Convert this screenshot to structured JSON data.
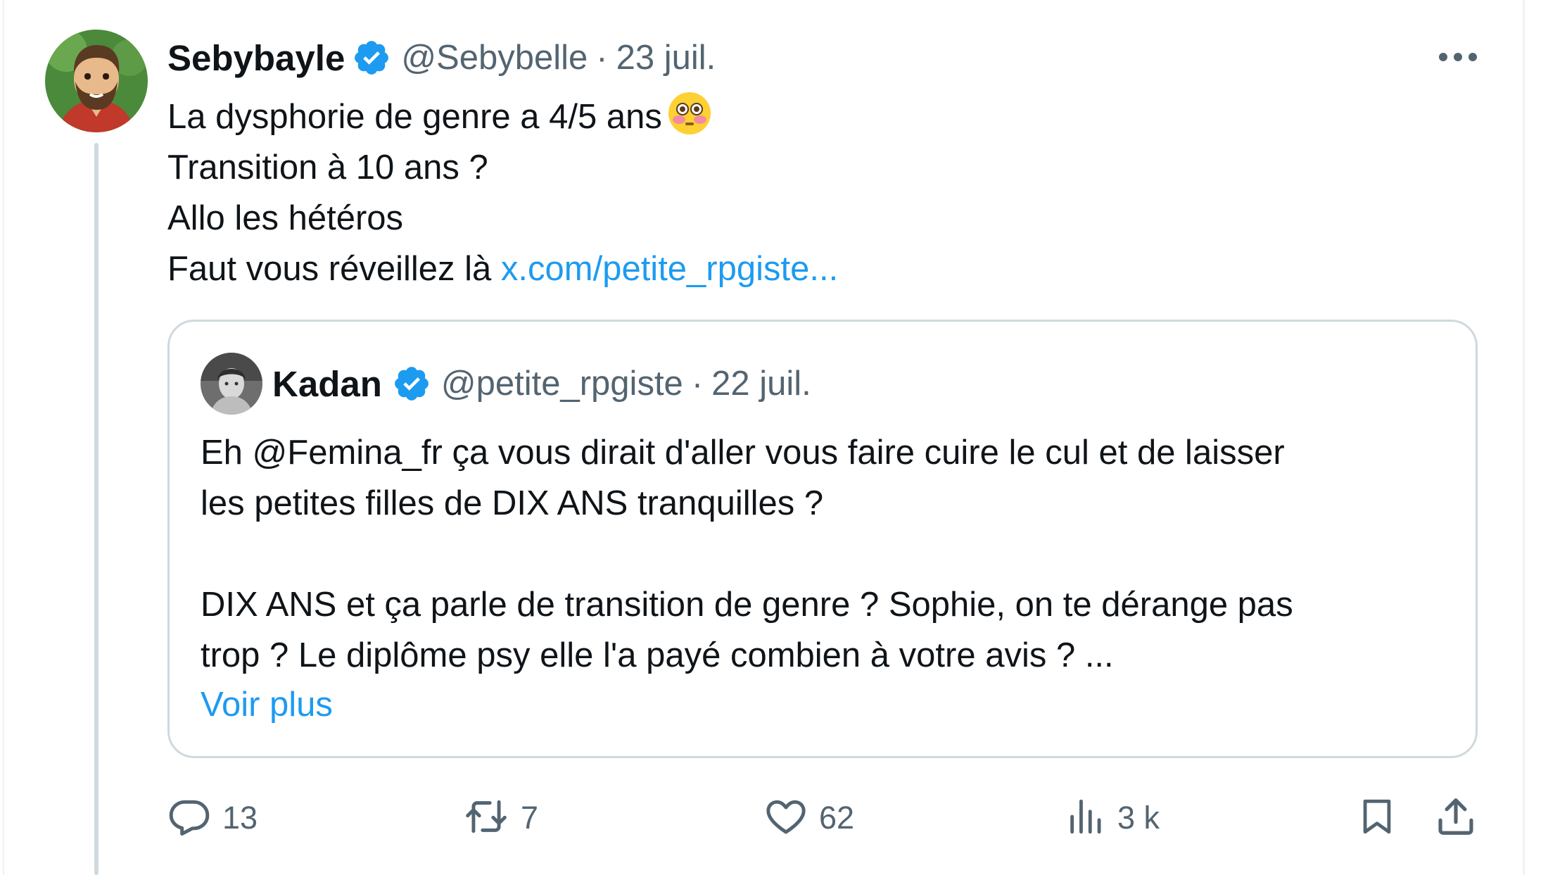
{
  "tweet": {
    "author_name": "Sebybayle",
    "author_handle": "@Sebybelle",
    "separator": "·",
    "date": "23 juil.",
    "text_lines": [
      "La dysphorie de genre a 4/5 ans",
      "Transition à 10 ans ?",
      "Allo les hétéros",
      "Faut vous réveillez là"
    ],
    "link_text": "x.com/petite_rpgiste...",
    "emoji": "flushed-face-emoji"
  },
  "quote": {
    "author_name": "Kadan",
    "author_handle": "@petite_rpgiste",
    "separator": "·",
    "date": "22 juil.",
    "text_lines": [
      "Eh @Femina_fr ça vous dirait d'aller vous faire cuire le cul et de laisser",
      "les petites filles de DIX ANS tranquilles ?",
      "",
      "DIX ANS et ça parle de transition de genre ? Sophie, on te dérange pas",
      "trop ? Le diplôme psy elle l'a payé combien à votre avis ? ..."
    ],
    "show_more": "Voir plus"
  },
  "actions": {
    "replies": "13",
    "reposts": "7",
    "likes": "62",
    "views": "3 k"
  },
  "icons": {
    "verified": "verified-badge-icon",
    "more": "more-options-icon",
    "reply": "reply-icon",
    "repost": "repost-icon",
    "like": "heart-icon",
    "views": "views-chart-icon",
    "bookmark": "bookmark-icon",
    "share": "share-icon"
  },
  "colors": {
    "text": "#0f1419",
    "secondary": "#536471",
    "link": "#1d9bf0",
    "border": "#cfd9de",
    "verified": "#1d9bf0"
  }
}
